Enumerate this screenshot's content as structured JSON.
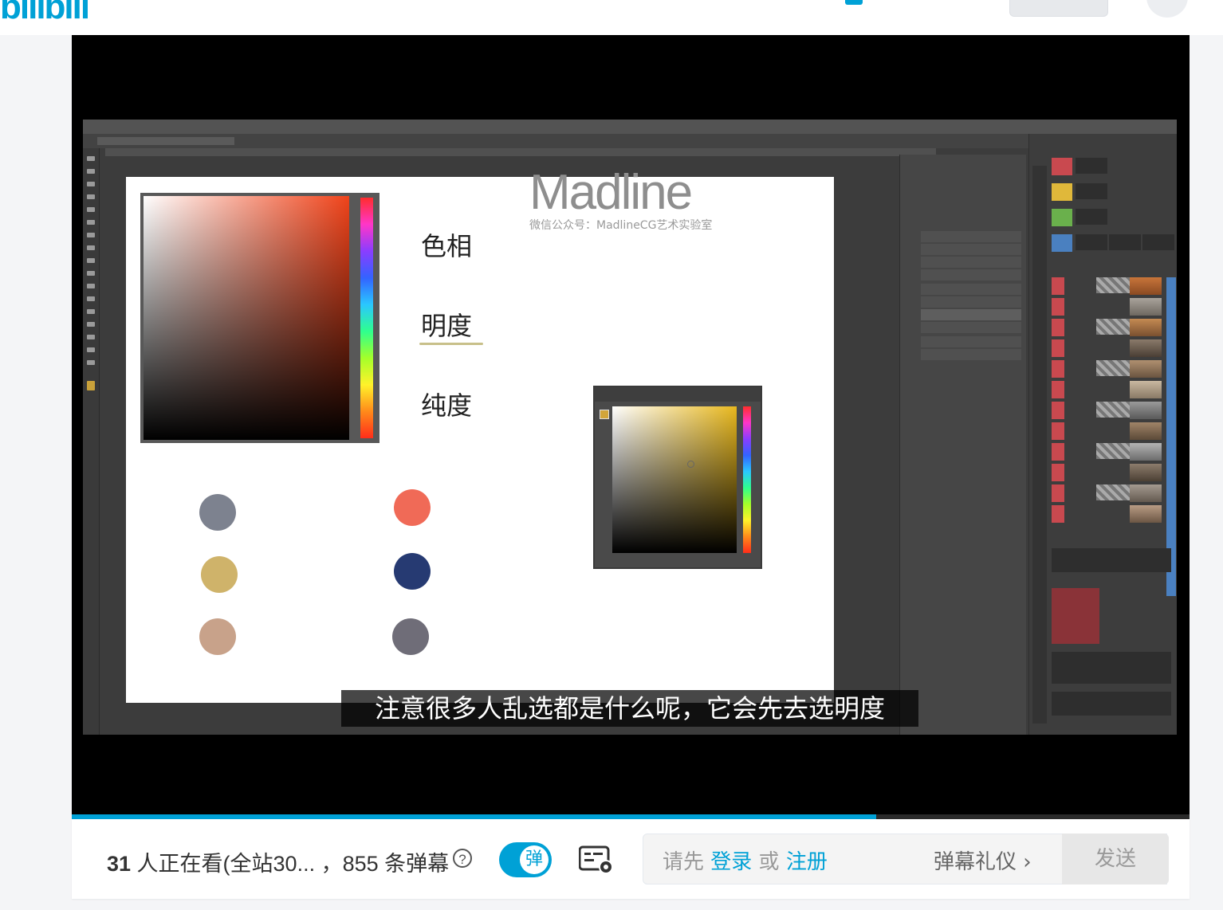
{
  "header": {
    "logo_text": "bilibili"
  },
  "video": {
    "watermark": "Madline",
    "watermark_sub": "微信公众号：MadlineCG艺术实验室",
    "labels": [
      "色相",
      "明度",
      "纯度"
    ],
    "swatches_left": [
      "#7d828f",
      "#cfb36a",
      "#c8a28a"
    ],
    "swatches_right": [
      "#f06a57",
      "#263a72",
      "#6f6d78"
    ],
    "subtitle": "注意很多人乱选都是什么呢，它会先去选明度",
    "progress_fraction": 0.72
  },
  "danmaku_bar": {
    "viewers_count": "31",
    "viewers_text": " 人正在看(全站30... ，855 条弹幕",
    "help": "?",
    "toggle_label": "弹",
    "input_prefix": "请先 ",
    "login": "登录",
    "or": " 或 ",
    "register": "注册",
    "etiquette": "弹幕礼仪 ›",
    "send": "发送"
  },
  "colors": {
    "accent": "#00a1d6"
  }
}
